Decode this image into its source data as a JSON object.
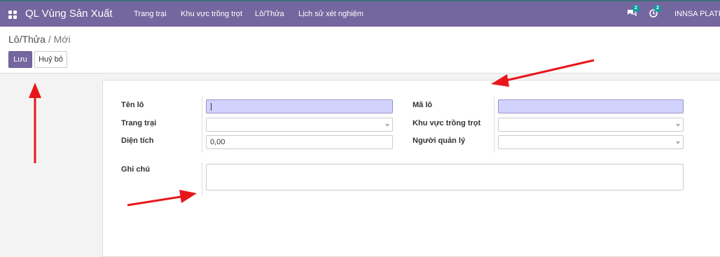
{
  "navbar": {
    "app_title": "QL Vùng Sản Xuất",
    "menu": [
      "Trang trại",
      "Khu vực trồng trọt",
      "Lô/Thửa",
      "Lịch sử xét nghiệm"
    ],
    "messages_badge": "2",
    "activities_badge": "2",
    "company": "INNSA PLATF"
  },
  "breadcrumb": {
    "parent": "Lô/Thửa",
    "separator": "/",
    "current": "Mới"
  },
  "buttons": {
    "save": "Lưu",
    "discard": "Huỷ bỏ"
  },
  "form": {
    "fields": {
      "lot_name": {
        "label": "Tên lô",
        "value": ""
      },
      "farm": {
        "label": "Trang trại",
        "value": ""
      },
      "area": {
        "label": "Diện tích",
        "value": "0,00"
      },
      "lot_code": {
        "label": "Mã lô",
        "value": ""
      },
      "growing_zone": {
        "label": "Khu vực trồng trọt",
        "value": ""
      },
      "manager": {
        "label": "Người quản lý",
        "value": ""
      },
      "note": {
        "label": "Ghi chú",
        "value": ""
      }
    }
  },
  "colors": {
    "navbar": "#74669e",
    "required_field": "#d2d2ff",
    "annotation_arrow": "#e8161b"
  }
}
